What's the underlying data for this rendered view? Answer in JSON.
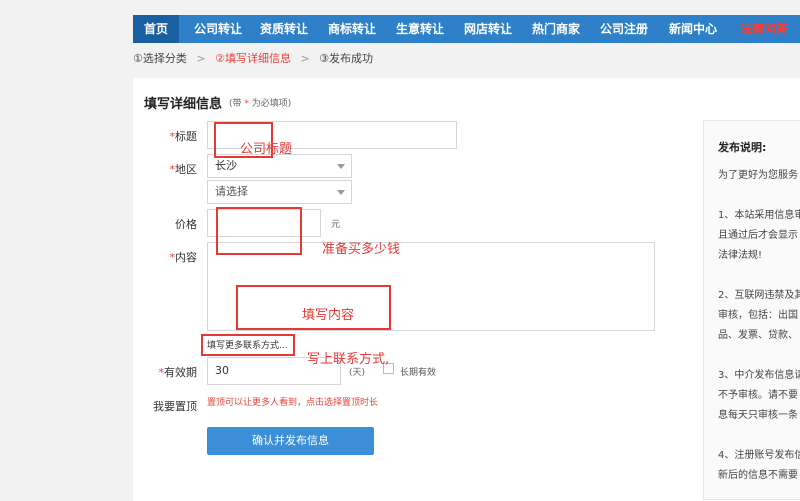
{
  "nav": {
    "items": [
      "首页",
      "公司转让",
      "资质转让",
      "商标转让",
      "生意转让",
      "网店转让",
      "热门商家",
      "公司注册",
      "新闻中心",
      "法律问答"
    ]
  },
  "steps": {
    "step1": "①选择分类",
    "step2": "②填写详细信息",
    "step3": "③发布成功",
    "sep": ">"
  },
  "form": {
    "section_title": "填写详细信息",
    "section_note_prefix": "(带",
    "section_note_star": "*",
    "section_note_suffix": "为必填项)",
    "required_mark": "*",
    "title_label": "标题",
    "region_label": "地区",
    "region_value": "长沙",
    "region_sub_placeholder": "请选择",
    "price_label": "价格",
    "price_unit": "元",
    "content_label": "内容",
    "more_contact": "填写更多联系方式...",
    "validity_label": "有效期",
    "validity_value": "30",
    "validity_unit": "(天)",
    "long_term_label": "长期有效",
    "top_label": "我要置顶",
    "top_hint": "置顶可以让更多人看到，点击选择置顶时长",
    "submit_label": "确认并发布信息"
  },
  "annotations": {
    "title": "公司标题",
    "price": "准备买多少钱",
    "content": "填写内容",
    "contact": "写上联系方式,"
  },
  "side": {
    "title": "发布说明:",
    "lines": [
      "为了更好为您服务",
      "1、本站采用信息审",
      "且通过后才会显示",
      "法律法规!",
      "2、互联网违禁及其",
      "审核，包括：出国",
      "品、发票、贷款、",
      "3、中介发布信息请",
      "不予审核。请不要",
      "息每天只审核一条",
      "4、注册账号发布信",
      "新后的信息不需要"
    ]
  },
  "colors": {
    "nav_bg": "#2e80c8",
    "nav_active": "#1a5fa0",
    "accent_red": "#e8413a",
    "annotation_red": "#e53935",
    "button_blue": "#3a8fd8"
  }
}
